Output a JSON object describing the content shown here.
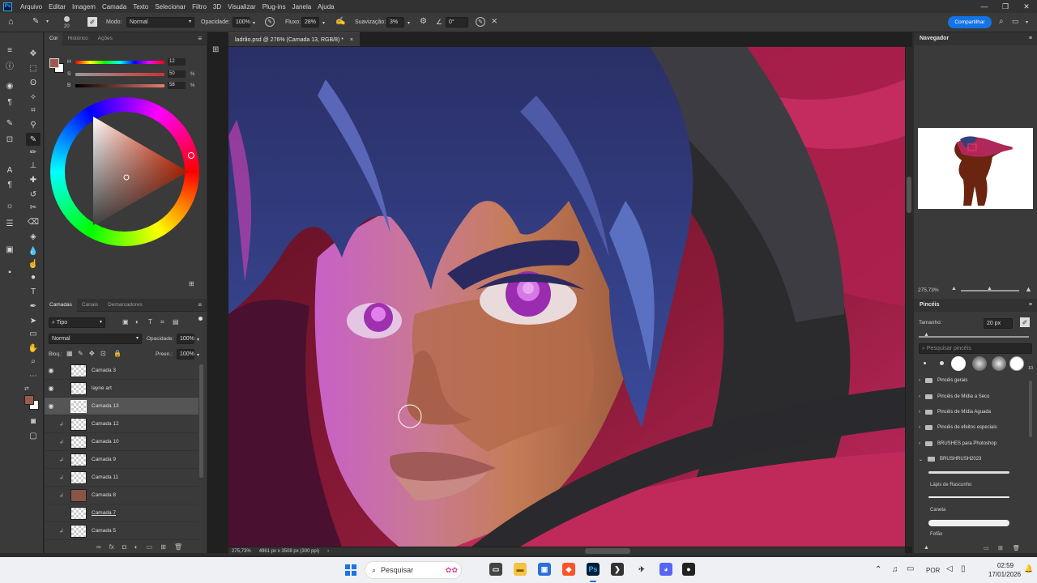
{
  "menubar": {
    "logo": "Ps",
    "items": [
      "Arquivo",
      "Editar",
      "Imagem",
      "Camada",
      "Texto",
      "Selecionar",
      "Filtro",
      "3D",
      "Visualizar",
      "Plug-ins",
      "Janela",
      "Ajuda"
    ]
  },
  "options": {
    "brush_size": "20",
    "mode_label": "Modo:",
    "mode_value": "Normal",
    "opacity_label": "Opacidade:",
    "opacity_value": "100%",
    "flow_label": "Fluxo:",
    "flow_value": "28%",
    "smoothing_label": "Suavização:",
    "smoothing_value": "3%",
    "angle_value": "0°",
    "share_label": "Compartilhar"
  },
  "color_panel": {
    "tabs": [
      "Cor",
      "Histórico",
      "Ações"
    ],
    "h_label": "H",
    "h_value": "12",
    "s_label": "S",
    "s_value": "50",
    "b_label": "B",
    "b_value": "58",
    "pct": "%",
    "foreground": "#9a5a4e",
    "background": "#ffffff"
  },
  "layers_panel": {
    "tabs": [
      "Camadas",
      "Canais",
      "Demarcadores"
    ],
    "filter_value": "Tipo",
    "blend_value": "Normal",
    "opacity_label": "Opacidade:",
    "opacity_value": "100%",
    "lock_label": "Bloq.:",
    "fill_label": "Preen.:",
    "fill_value": "100%",
    "layers": [
      {
        "name": "Camada 3",
        "visible": true,
        "clipped": false
      },
      {
        "name": "layne art",
        "visible": true,
        "clipped": false
      },
      {
        "name": "Camada 13",
        "visible": true,
        "clipped": false,
        "selected": true
      },
      {
        "name": "Camada 12",
        "visible": false,
        "clipped": true
      },
      {
        "name": "Camada 10",
        "visible": false,
        "clipped": true
      },
      {
        "name": "Camada 9",
        "visible": false,
        "clipped": true
      },
      {
        "name": "Camada 11",
        "visible": false,
        "clipped": true
      },
      {
        "name": "Camada 8",
        "visible": false,
        "clipped": true
      },
      {
        "name": "Camada 7",
        "visible": false,
        "clipped": false
      },
      {
        "name": "Camada 5",
        "visible": false,
        "clipped": true
      }
    ]
  },
  "document": {
    "tab_title": "ladrão.psd @ 276% (Camada 13, RGB/8) *",
    "zoom": "275,73%",
    "dimensions": "4961 px x 3508 px (300 ppi)"
  },
  "navigator": {
    "title": "Navegador",
    "zoom": "275,73%"
  },
  "brushes": {
    "title": "Pincéis",
    "size_label": "Tamanho:",
    "size_value": "20 px",
    "search_placeholder": "Pesquisar pincéis",
    "preset_count": "10",
    "folders": [
      "Pincéis gerais",
      "Pincéis de Mídia a Seco",
      "Pincéis de Mídia Aguada",
      "Pincéis de efeitos especiais",
      "BRUSHES para Photoshop",
      "BRUSHRUSH2023"
    ],
    "brush_items": [
      "Lápis de Rascunho",
      "Caneta",
      "Fofão"
    ]
  },
  "taskbar": {
    "search": "Pesquisar",
    "language": "POR",
    "time": "02:59",
    "date": "17/01/2026"
  }
}
